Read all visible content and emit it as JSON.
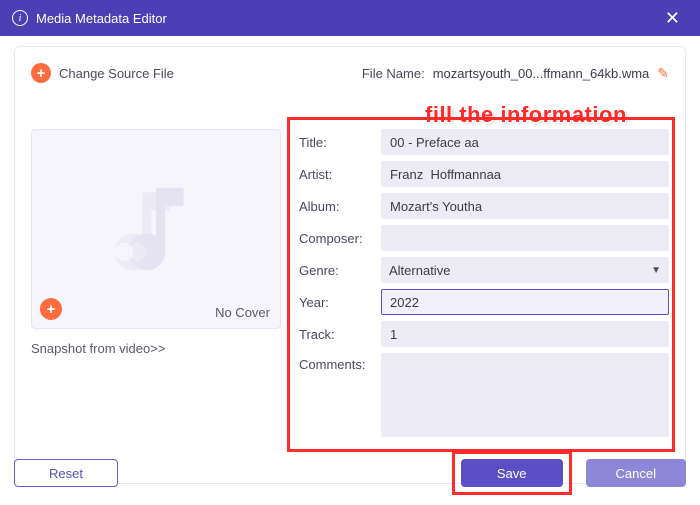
{
  "window": {
    "title": "Media Metadata Editor"
  },
  "topbar": {
    "change_label": "Change Source File",
    "file_name_label": "File Name:",
    "file_name_value": "mozartsyouth_00...ffmann_64kb.wma"
  },
  "callout": "fill the information",
  "cover": {
    "no_cover_label": "No Cover",
    "snapshot_link": "Snapshot from video>>"
  },
  "form": {
    "title_label": "Title:",
    "title_value": "00 - Preface aa",
    "artist_label": "Artist:",
    "artist_value": "Franz  Hoffmannaa",
    "album_label": "Album:",
    "album_value": "Mozart's Youtha",
    "composer_label": "Composer:",
    "composer_value": "",
    "genre_label": "Genre:",
    "genre_value": "Alternative",
    "year_label": "Year:",
    "year_value": "2022",
    "track_label": "Track:",
    "track_value": "1",
    "comments_label": "Comments:",
    "comments_value": ""
  },
  "buttons": {
    "reset": "Reset",
    "save": "Save",
    "cancel": "Cancel"
  }
}
